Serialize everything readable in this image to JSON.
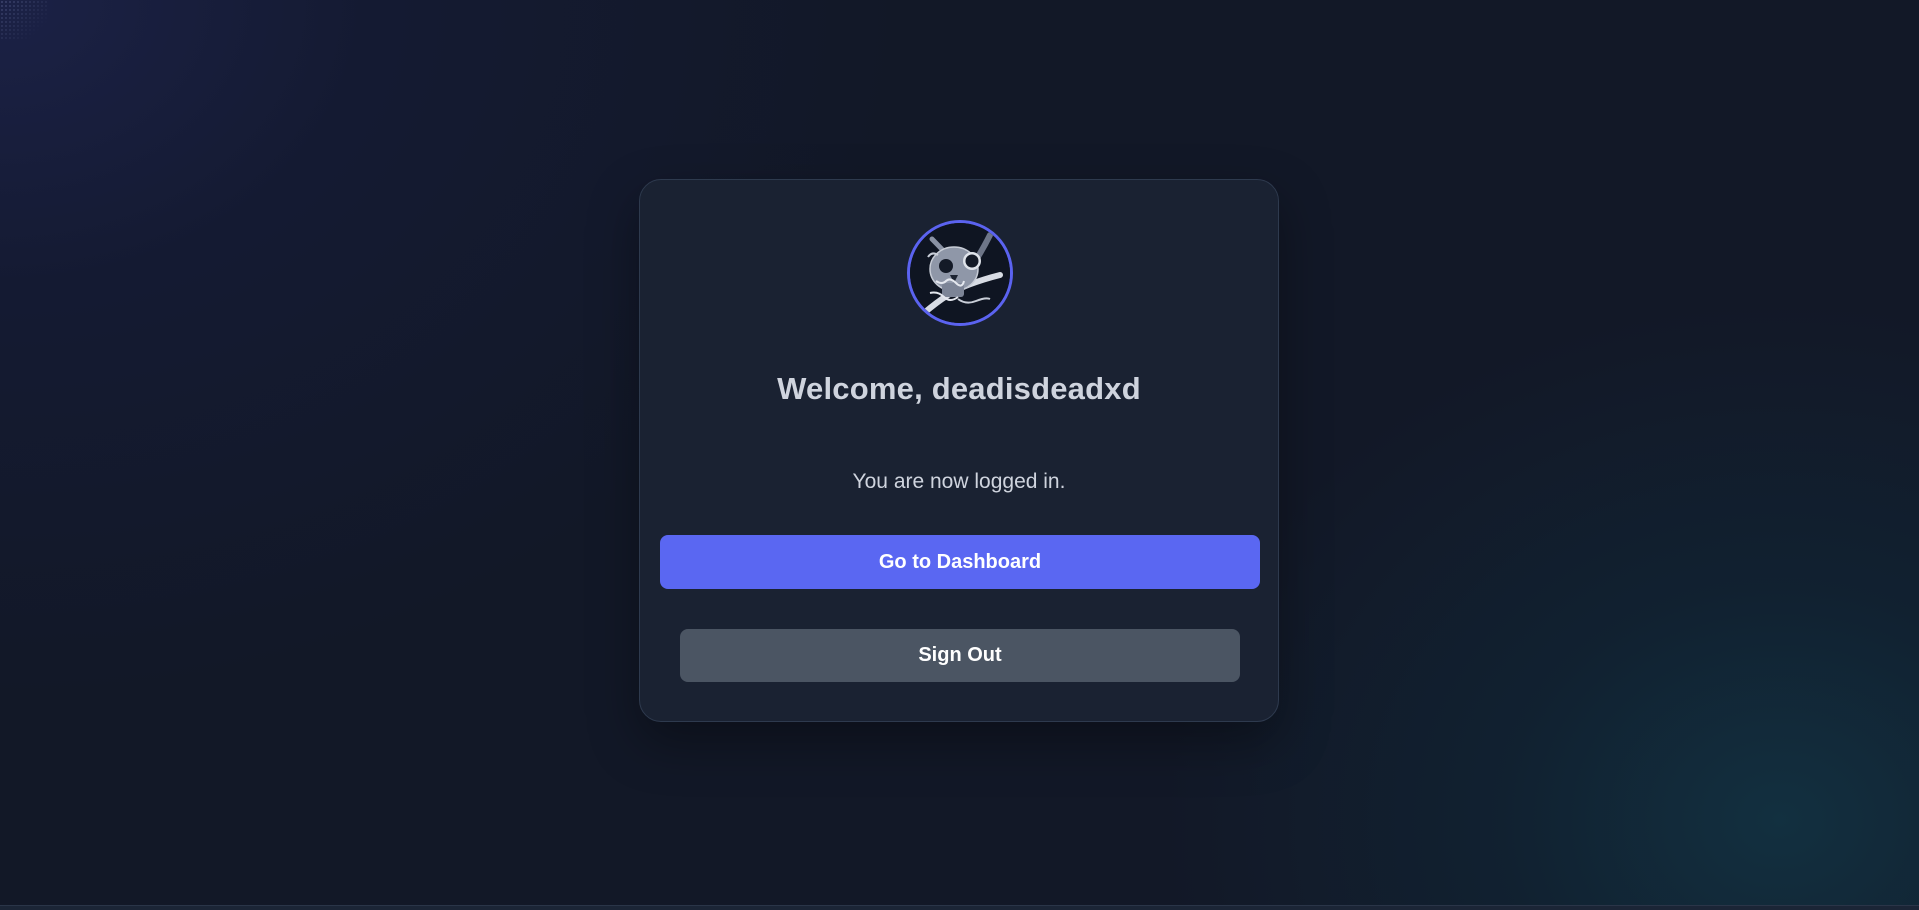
{
  "welcome": {
    "title": "Welcome, deadisdeadxd",
    "subtitle": "You are now logged in."
  },
  "avatar": {
    "icon": "skull-and-crossbones-avatar",
    "ring_color": "#5b63f0"
  },
  "buttons": {
    "dashboard_label": "Go to Dashboard",
    "signout_label": "Sign Out"
  },
  "colors": {
    "accent": "#5a67f2",
    "secondary_button": "#4b5563",
    "card_background": "#1a2232",
    "page_background": "#121827",
    "text": "#cfd4de"
  }
}
